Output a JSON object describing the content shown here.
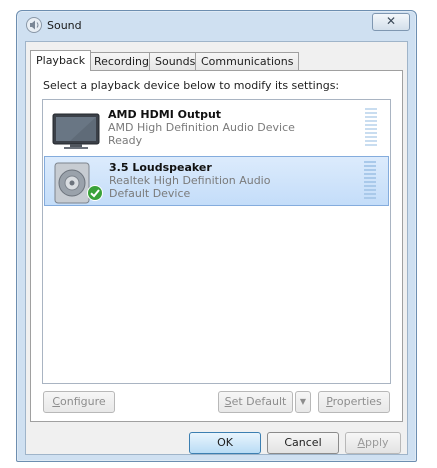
{
  "window": {
    "title": "Sound",
    "close_glyph": "✕"
  },
  "tabs": [
    {
      "label": "Playback",
      "active": true
    },
    {
      "label": "Recording",
      "active": false
    },
    {
      "label": "Sounds",
      "active": false
    },
    {
      "label": "Communications",
      "active": false
    }
  ],
  "panel": {
    "instructions": "Select a playback device below to modify its settings:"
  },
  "devices": [
    {
      "name": "AMD HDMI Output",
      "description": "AMD High Definition Audio Device",
      "status": "Ready",
      "icon": "monitor-icon",
      "selected": false
    },
    {
      "name": "3.5 Loudspeaker",
      "description": "Realtek High Definition Audio",
      "status": "Default Device",
      "icon": "speaker-icon",
      "default_badge_icon": "green-check-icon",
      "selected": true
    }
  ],
  "panel_buttons": {
    "configure_prefix": "C",
    "configure_rest": "onfigure",
    "set_default_prefix": "S",
    "set_default_rest": "et Default",
    "set_default_arrow": "▼",
    "properties_prefix": "P",
    "properties_rest": "roperties"
  },
  "footer_buttons": {
    "ok": "OK",
    "cancel": "Cancel",
    "apply_prefix": "A",
    "apply_rest": "pply"
  },
  "colors": {
    "selection": "#c4ddf9",
    "check_badge": "#3aa23a",
    "window_frame": "#cfe0f1"
  }
}
